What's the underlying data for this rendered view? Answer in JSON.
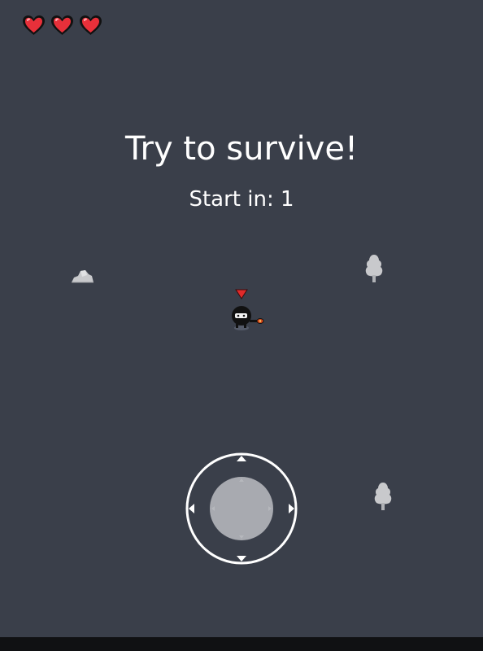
{
  "hud": {
    "hearts": [
      {
        "icon": "heart-icon",
        "state": "full"
      },
      {
        "icon": "heart-icon",
        "state": "full"
      },
      {
        "icon": "heart-icon",
        "state": "full"
      }
    ]
  },
  "message": {
    "title": "Try to survive!",
    "countdown": "Start in: 1"
  },
  "colors": {
    "background": "#3a3f4a",
    "heart": "#e8303a",
    "text": "#ffffff",
    "joystick_knob": "#a8aab0",
    "joystick_ring": "#ffffff",
    "prop": "#c8c9cc"
  },
  "world": {
    "props": [
      "rock-icon",
      "tree-icon",
      "tree-icon"
    ],
    "player": {
      "icon": "player-icon",
      "marker": "red-triangle-marker-icon"
    }
  },
  "controls": {
    "joystick": {
      "icon": "virtual-joystick",
      "arrows": [
        "arrow-up-icon",
        "arrow-down-icon",
        "arrow-left-icon",
        "arrow-right-icon"
      ]
    }
  }
}
